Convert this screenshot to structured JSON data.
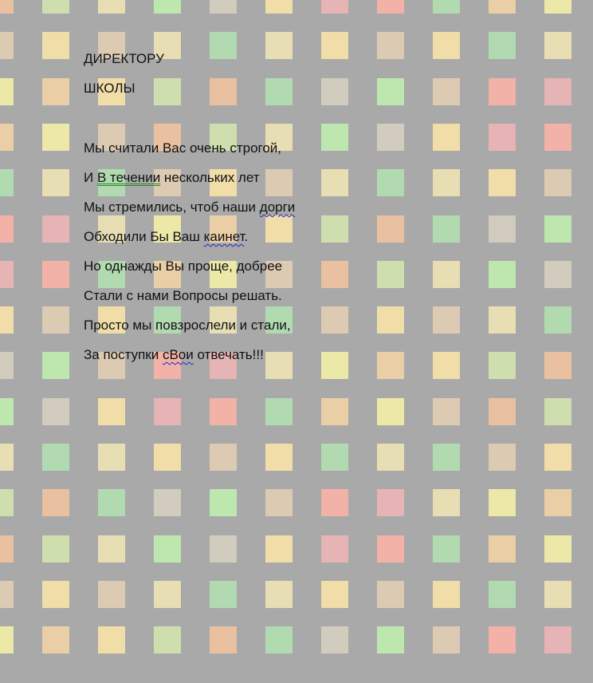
{
  "document": {
    "heading_line1": "ДИРЕКТОРУ",
    "heading_line2": "ШКОЛЫ",
    "poem": [
      {
        "segments": [
          {
            "text": "Мы считали Вас очень строгой,"
          }
        ]
      },
      {
        "segments": [
          {
            "text": "И "
          },
          {
            "text": "В течении",
            "mark": "grammar"
          },
          {
            "text": " нескольких лет"
          }
        ]
      },
      {
        "segments": [
          {
            "text": "Мы стремились, чтоб наши "
          },
          {
            "text": "дорги",
            "mark": "spell"
          }
        ]
      },
      {
        "segments": [
          {
            "text": "Обходили Бы Ваш "
          },
          {
            "text": "каинет",
            "mark": "spell"
          },
          {
            "text": "."
          }
        ]
      },
      {
        "segments": [
          {
            "text": "Но однажды Вы проще, добрее"
          }
        ]
      },
      {
        "segments": [
          {
            "text": "Стали с нами Вопросы решать."
          }
        ]
      },
      {
        "segments": [
          {
            "text": "Просто мы повзрослели и стали,"
          }
        ]
      },
      {
        "segments": [
          {
            "text": "За поступки "
          },
          {
            "text": "сВои",
            "mark": "spell"
          },
          {
            "text": " отвечать!!!"
          }
        ]
      }
    ]
  },
  "background": {
    "base_color": "#a9a9a9",
    "tile_palette": [
      "#f5c6a0",
      "#fde6a8",
      "#f8f5a8",
      "#c2f2b2",
      "#b3e3b3",
      "#d6e8b0",
      "#f1b6b6",
      "#e6d0b4",
      "#d9d2c2",
      "#f6d6a6",
      "#f2e8b6",
      "#ffb4a8"
    ]
  }
}
